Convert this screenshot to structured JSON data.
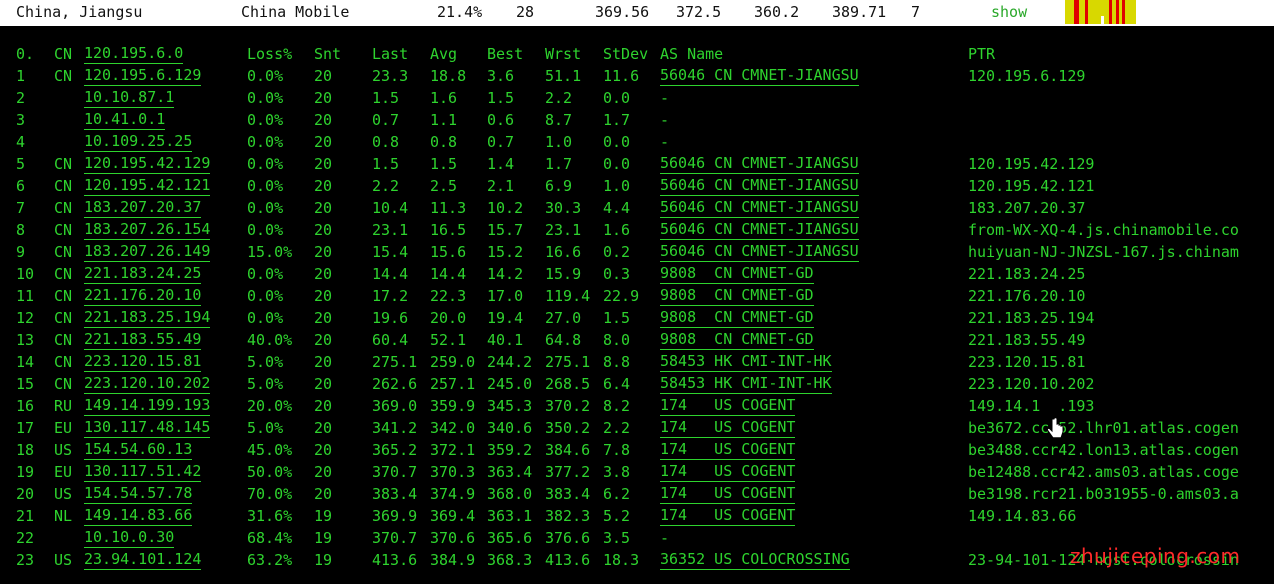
{
  "summary": {
    "location": "China, Jiangsu",
    "isp": "China Mobile",
    "loss": "21.4%",
    "snt": "28",
    "last": "369.56",
    "avg": "372.5",
    "best": "360.2",
    "wrst": "389.71",
    "hops": "7",
    "show_label": "show"
  },
  "headers": {
    "hop": "0.",
    "cc": "CN",
    "host": "120.195.6.0",
    "loss": "Loss%",
    "snt": "Snt",
    "last": "Last",
    "avg": "Avg",
    "best": "Best",
    "wrst": "Wrst",
    "stdev": "StDev",
    "asname": "AS Name",
    "ptr": "PTR"
  },
  "rows": [
    {
      "hop": "1",
      "cc": "CN",
      "host": "120.195.6.129",
      "loss": "0.0%",
      "snt": "20",
      "last": "23.3",
      "avg": "18.8",
      "best": "3.6",
      "wrst": "51.1",
      "stdev": "11.6",
      "asn": "56046 CN CMNET-JIANGSU",
      "ptr": "120.195.6.129"
    },
    {
      "hop": "2",
      "cc": "",
      "host": "10.10.87.1",
      "loss": "0.0%",
      "snt": "20",
      "last": "1.5",
      "avg": "1.6",
      "best": "1.5",
      "wrst": "2.2",
      "stdev": "0.0",
      "asn": "-",
      "ptr": ""
    },
    {
      "hop": "3",
      "cc": "",
      "host": "10.41.0.1",
      "loss": "0.0%",
      "snt": "20",
      "last": "0.7",
      "avg": "1.1",
      "best": "0.6",
      "wrst": "8.7",
      "stdev": "1.7",
      "asn": "-",
      "ptr": ""
    },
    {
      "hop": "4",
      "cc": "",
      "host": "10.109.25.25",
      "loss": "0.0%",
      "snt": "20",
      "last": "0.8",
      "avg": "0.8",
      "best": "0.7",
      "wrst": "1.0",
      "stdev": "0.0",
      "asn": "-",
      "ptr": ""
    },
    {
      "hop": "5",
      "cc": "CN",
      "host": "120.195.42.129",
      "loss": "0.0%",
      "snt": "20",
      "last": "1.5",
      "avg": "1.5",
      "best": "1.4",
      "wrst": "1.7",
      "stdev": "0.0",
      "asn": "56046 CN CMNET-JIANGSU",
      "ptr": "120.195.42.129"
    },
    {
      "hop": "6",
      "cc": "CN",
      "host": "120.195.42.121",
      "loss": "0.0%",
      "snt": "20",
      "last": "2.2",
      "avg": "2.5",
      "best": "2.1",
      "wrst": "6.9",
      "stdev": "1.0",
      "asn": "56046 CN CMNET-JIANGSU",
      "ptr": "120.195.42.121"
    },
    {
      "hop": "7",
      "cc": "CN",
      "host": "183.207.20.37",
      "loss": "0.0%",
      "snt": "20",
      "last": "10.4",
      "avg": "11.3",
      "best": "10.2",
      "wrst": "30.3",
      "stdev": "4.4",
      "asn": "56046 CN CMNET-JIANGSU",
      "ptr": "183.207.20.37"
    },
    {
      "hop": "8",
      "cc": "CN",
      "host": "183.207.26.154",
      "loss": "0.0%",
      "snt": "20",
      "last": "23.1",
      "avg": "16.5",
      "best": "15.7",
      "wrst": "23.1",
      "stdev": "1.6",
      "asn": "56046 CN CMNET-JIANGSU",
      "ptr": "from-WX-XQ-4.js.chinamobile.co"
    },
    {
      "hop": "9",
      "cc": "CN",
      "host": "183.207.26.149",
      "loss": "15.0%",
      "snt": "20",
      "last": "15.4",
      "avg": "15.6",
      "best": "15.2",
      "wrst": "16.6",
      "stdev": "0.2",
      "asn": "56046 CN CMNET-JIANGSU",
      "ptr": "huiyuan-NJ-JNZSL-167.js.chinam"
    },
    {
      "hop": "10",
      "cc": "CN",
      "host": "221.183.24.25",
      "loss": "0.0%",
      "snt": "20",
      "last": "14.4",
      "avg": "14.4",
      "best": "14.2",
      "wrst": "15.9",
      "stdev": "0.3",
      "asn": "9808  CN CMNET-GD",
      "ptr": "221.183.24.25"
    },
    {
      "hop": "11",
      "cc": "CN",
      "host": "221.176.20.10",
      "loss": "0.0%",
      "snt": "20",
      "last": "17.2",
      "avg": "22.3",
      "best": "17.0",
      "wrst": "119.4",
      "stdev": "22.9",
      "asn": "9808  CN CMNET-GD",
      "ptr": "221.176.20.10"
    },
    {
      "hop": "12",
      "cc": "CN",
      "host": "221.183.25.194",
      "loss": "0.0%",
      "snt": "20",
      "last": "19.6",
      "avg": "20.0",
      "best": "19.4",
      "wrst": "27.0",
      "stdev": "1.5",
      "asn": "9808  CN CMNET-GD",
      "ptr": "221.183.25.194"
    },
    {
      "hop": "13",
      "cc": "CN",
      "host": "221.183.55.49",
      "loss": "40.0%",
      "snt": "20",
      "last": "60.4",
      "avg": "52.1",
      "best": "40.1",
      "wrst": "64.8",
      "stdev": "8.0",
      "asn": "9808  CN CMNET-GD",
      "ptr": "221.183.55.49"
    },
    {
      "hop": "14",
      "cc": "CN",
      "host": "223.120.15.81",
      "loss": "5.0%",
      "snt": "20",
      "last": "275.1",
      "avg": "259.0",
      "best": "244.2",
      "wrst": "275.1",
      "stdev": "8.8",
      "asn": "58453 HK CMI-INT-HK",
      "ptr": "223.120.15.81"
    },
    {
      "hop": "15",
      "cc": "CN",
      "host": "223.120.10.202",
      "loss": "5.0%",
      "snt": "20",
      "last": "262.6",
      "avg": "257.1",
      "best": "245.0",
      "wrst": "268.5",
      "stdev": "6.4",
      "asn": "58453 HK CMI-INT-HK",
      "ptr": "223.120.10.202"
    },
    {
      "hop": "16",
      "cc": "RU",
      "host": "149.14.199.193",
      "loss": "20.0%",
      "snt": "20",
      "last": "369.0",
      "avg": "359.9",
      "best": "345.3",
      "wrst": "370.2",
      "stdev": "8.2",
      "asn": "174   US COGENT",
      "ptr": "149.14.1  .193"
    },
    {
      "hop": "17",
      "cc": "EU",
      "host": "130.117.48.145",
      "loss": "5.0%",
      "snt": "20",
      "last": "341.2",
      "avg": "342.0",
      "best": "340.6",
      "wrst": "350.2",
      "stdev": "2.2",
      "asn": "174   US COGENT",
      "ptr": "be3672.ccr52.lhr01.atlas.cogen"
    },
    {
      "hop": "18",
      "cc": "US",
      "host": "154.54.60.13",
      "loss": "45.0%",
      "snt": "20",
      "last": "365.2",
      "avg": "372.1",
      "best": "359.2",
      "wrst": "384.6",
      "stdev": "7.8",
      "asn": "174   US COGENT",
      "ptr": "be3488.ccr42.lon13.atlas.cogen"
    },
    {
      "hop": "19",
      "cc": "EU",
      "host": "130.117.51.42",
      "loss": "50.0%",
      "snt": "20",
      "last": "370.7",
      "avg": "370.3",
      "best": "363.4",
      "wrst": "377.2",
      "stdev": "3.8",
      "asn": "174   US COGENT",
      "ptr": "be12488.ccr42.ams03.atlas.coge"
    },
    {
      "hop": "20",
      "cc": "US",
      "host": "154.54.57.78",
      "loss": "70.0%",
      "snt": "20",
      "last": "383.4",
      "avg": "374.9",
      "best": "368.0",
      "wrst": "383.4",
      "stdev": "6.2",
      "asn": "174   US COGENT",
      "ptr": "be3198.rcr21.b031955-0.ams03.a"
    },
    {
      "hop": "21",
      "cc": "NL",
      "host": "149.14.83.66",
      "loss": "31.6%",
      "snt": "19",
      "last": "369.9",
      "avg": "369.4",
      "best": "363.1",
      "wrst": "382.3",
      "stdev": "5.2",
      "asn": "174   US COGENT",
      "ptr": "149.14.83.66"
    },
    {
      "hop": "22",
      "cc": "",
      "host": "10.10.0.30",
      "loss": "68.4%",
      "snt": "19",
      "last": "370.7",
      "avg": "370.6",
      "best": "365.6",
      "wrst": "376.6",
      "stdev": "3.5",
      "asn": "-",
      "ptr": ""
    },
    {
      "hop": "23",
      "cc": "US",
      "host": "23.94.101.124",
      "loss": "63.2%",
      "snt": "19",
      "last": "413.6",
      "avg": "384.9",
      "best": "368.3",
      "wrst": "413.6",
      "stdev": "18.3",
      "asn": "36352 US COLOCROSSING",
      "ptr": "23-94-101-124-host.colocrossin"
    }
  ],
  "watermark": "zhujiceping.com",
  "colors": {
    "terminal_green": "#2ed32e",
    "mini_chart_yellow": "#d8d800",
    "mini_chart_red": "#e00000",
    "watermark_red": "#ff2a2a"
  }
}
